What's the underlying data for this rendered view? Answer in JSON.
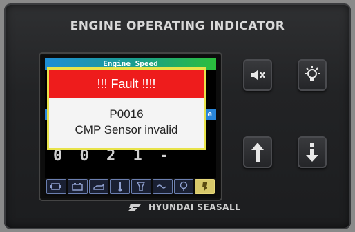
{
  "panel": {
    "title": "ENGINE OPERATING INDICATOR",
    "brand": "HYUNDAI SEASALL"
  },
  "screen": {
    "top_bar_label": "Engine Speed",
    "mid_bar_label": "e",
    "background_digits": "0 0 2 1 -"
  },
  "fault_dialog": {
    "header": "!!! Fault !!!!",
    "code": "P0016",
    "message": "CMP Sensor invalid"
  },
  "status_icons": [
    {
      "name": "engine-icon",
      "active": false
    },
    {
      "name": "battery-icon",
      "active": false
    },
    {
      "name": "oil-pressure-icon",
      "active": false
    },
    {
      "name": "temperature-icon",
      "active": false
    },
    {
      "name": "filter-icon",
      "active": false
    },
    {
      "name": "glow-plug-icon",
      "active": false
    },
    {
      "name": "warning-icon",
      "active": false
    },
    {
      "name": "alert-icon",
      "active": true
    }
  ],
  "buttons": [
    "mute-button",
    "backlight-button",
    "up-button",
    "down-button"
  ],
  "colors": {
    "fault_red": "#ee1c1c",
    "dialog_border": "#e8e34a",
    "bar_blue": "#2a86d9",
    "bar_green": "#2bbf3c"
  }
}
